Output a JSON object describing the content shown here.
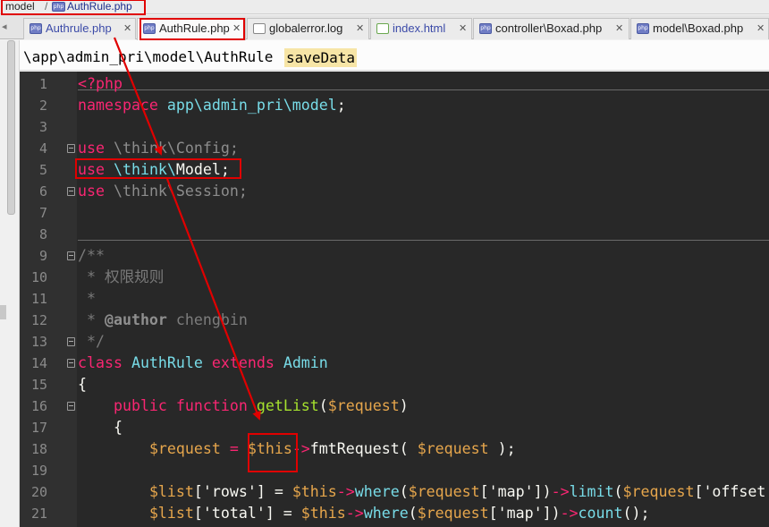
{
  "breadcrumb": {
    "folder": "model",
    "file": "AuthRule.php"
  },
  "tabs": [
    {
      "label": "Authrule.php",
      "icon": "php-file-icon",
      "active": false
    },
    {
      "label": "AuthRule.php",
      "icon": "php-file-icon",
      "active": true
    },
    {
      "label": "globalerror.log",
      "icon": "log-file-icon",
      "active": false
    },
    {
      "label": "index.html",
      "icon": "html-file-icon",
      "active": false
    },
    {
      "label": "controller\\Boxad.php",
      "icon": "php-file-icon",
      "active": false
    },
    {
      "label": "model\\Boxad.php",
      "icon": "php-file-icon",
      "active": false
    }
  ],
  "navigation": {
    "path": "\\app\\admin_pri\\model\\AuthRule",
    "method": "saveData"
  },
  "editor": {
    "line_numbers": [
      "1",
      "2",
      "3",
      "4",
      "5",
      "6",
      "7",
      "8",
      "9",
      "10",
      "11",
      "12",
      "13",
      "14",
      "15",
      "16",
      "17",
      "18",
      "19",
      "20",
      "21"
    ],
    "tokens": {
      "l1_open": "<?php",
      "l2_ns": "namespace",
      "l2_name": "app\\admin_pri\\model",
      "l2_semi": ";",
      "l4_use": "use",
      "l4_path": "\\think\\Config;",
      "l5_use": "use",
      "l5_think": "\\think\\",
      "l5_model": "Model",
      "l5_semi": ";",
      "l6_use": "use",
      "l6_path": "\\think\\Session;",
      "l9_doc": "/**",
      "l10_doc": " * 权限规则",
      "l11_doc": " *",
      "l12_star": " * ",
      "l12_tag": "@author",
      "l12_name": " chengbin",
      "l13_doc": " */",
      "l14_class": "class",
      "l14_name": "AuthRule",
      "l14_extends": "extends",
      "l14_parent": "Admin",
      "l15_brace": "{",
      "l16_public": "public",
      "l16_function": "function",
      "l16_name": "getList",
      "l16_open": "(",
      "l16_param": "$request",
      "l16_close": ")",
      "l17_brace": "{",
      "l18_var": "$request",
      "l18_eq": " = ",
      "l18_this": "$this",
      "l18_arrow": "->",
      "l18_method": "fmtRequest",
      "l18_open": "( ",
      "l18_param": "$request",
      "l18_close": " );",
      "l20_list": "$list",
      "l20_key": "['rows']",
      "l20_eq": " = ",
      "l20_this": "$this",
      "l20_a1": "->",
      "l20_where": "where",
      "l20_p1": "(",
      "l20_req": "$request",
      "l20_map": "['map']",
      "l20_p2": ")",
      "l20_a2": "->",
      "l20_limit": "limit",
      "l20_p3": "(",
      "l20_req2": "$request",
      "l20_offset": "['offset",
      "l21_list": "$list",
      "l21_key": "['total']",
      "l21_eq": " = ",
      "l21_this": "$this",
      "l21_a1": "->",
      "l21_where": "where",
      "l21_p1": "(",
      "l21_req": "$request",
      "l21_map": "['map']",
      "l21_p2": ")",
      "l21_a2": "->",
      "l21_count": "count",
      "l21_end": "();"
    }
  },
  "annotations": {
    "highlight_color": "#e00000"
  }
}
